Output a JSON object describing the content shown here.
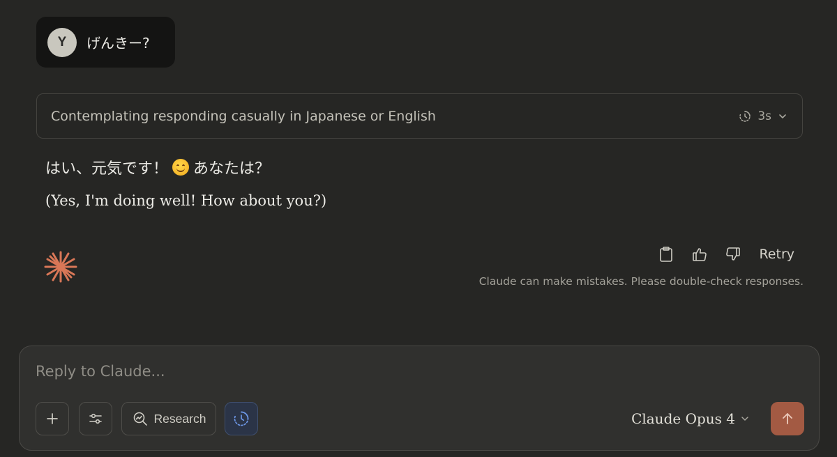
{
  "user_message": {
    "avatar_initial": "Y",
    "text": "げんきー?"
  },
  "thinking": {
    "label": "Contemplating responding casually in Japanese or English",
    "duration": "3s"
  },
  "response": {
    "japanese_before_emoji": "はい、元気です！",
    "japanese_after_emoji": "あなたは？",
    "english": "(Yes, I'm doing well! How about you?)"
  },
  "actions": {
    "retry_label": "Retry"
  },
  "disclaimer": "Claude can make mistakes. Please double-check responses.",
  "composer": {
    "placeholder": "Reply to Claude...",
    "research_label": "Research",
    "model_label": "Claude Opus 4"
  },
  "colors": {
    "background": "#262624",
    "accent": "#d97757",
    "send_button": "#a35a43",
    "active_tool": "#2b3447"
  }
}
